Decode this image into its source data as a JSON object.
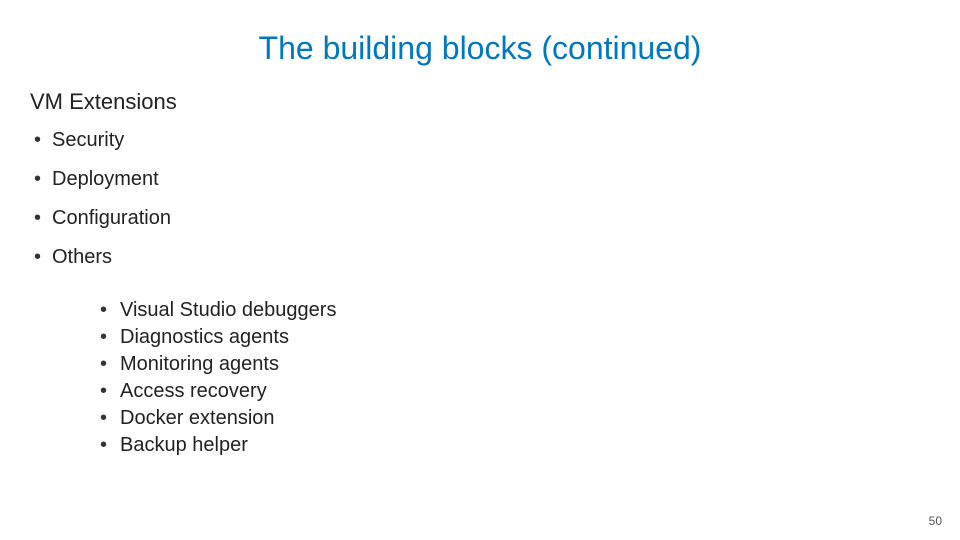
{
  "title": "The building blocks (continued)",
  "subtitle": "VM Extensions",
  "bullets": {
    "0": "Security",
    "1": "Deployment",
    "2": "Configuration",
    "3": "Others"
  },
  "sub": {
    "0": "Visual Studio debuggers",
    "1": "Diagnostics agents",
    "2": "Monitoring agents",
    "3": "Access recovery",
    "4": "Docker extension",
    "5": "Backup helper"
  },
  "pagenum": "50"
}
